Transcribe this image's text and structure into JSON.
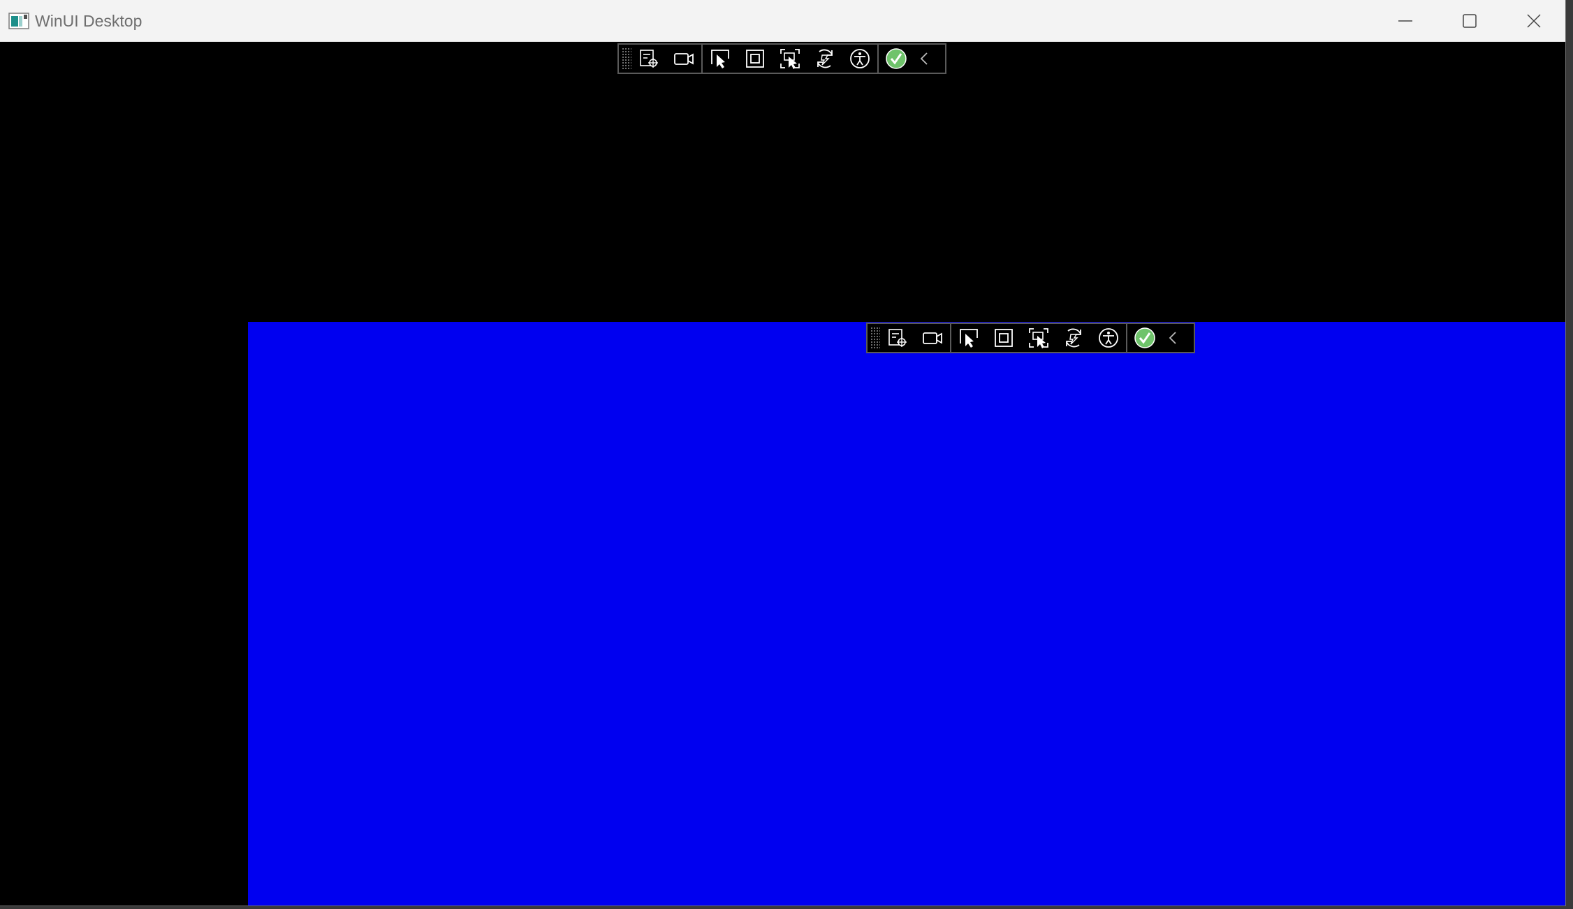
{
  "window": {
    "title": "WinUI Desktop",
    "app_icon": "winui-app-icon",
    "caption_buttons": [
      {
        "name": "minimize",
        "icon": "minimize-icon"
      },
      {
        "name": "maximize",
        "icon": "maximize-icon"
      },
      {
        "name": "close",
        "icon": "close-icon"
      }
    ]
  },
  "colors": {
    "content_background": "#000000",
    "panel_background": "#0000f0",
    "titlebar_background": "#f3f3f3",
    "toolbar_check_green": "#6fc36b"
  },
  "debug_toolbar": {
    "buttons": [
      {
        "name": "live-visual-tree",
        "icon": "visual-tree-icon"
      },
      {
        "name": "record",
        "icon": "camera-icon"
      },
      {
        "name": "select-element",
        "icon": "select-element-icon"
      },
      {
        "name": "display-layout-adorners",
        "icon": "layout-adorner-icon"
      },
      {
        "name": "track-focused-element",
        "icon": "track-focus-icon"
      },
      {
        "name": "hot-reload",
        "icon": "hot-reload-icon"
      },
      {
        "name": "accessibility",
        "icon": "accessibility-icon"
      },
      {
        "name": "binding-status-ok",
        "icon": "check-circle-icon"
      },
      {
        "name": "collapse-toolbar",
        "icon": "chevron-left-icon"
      }
    ]
  }
}
